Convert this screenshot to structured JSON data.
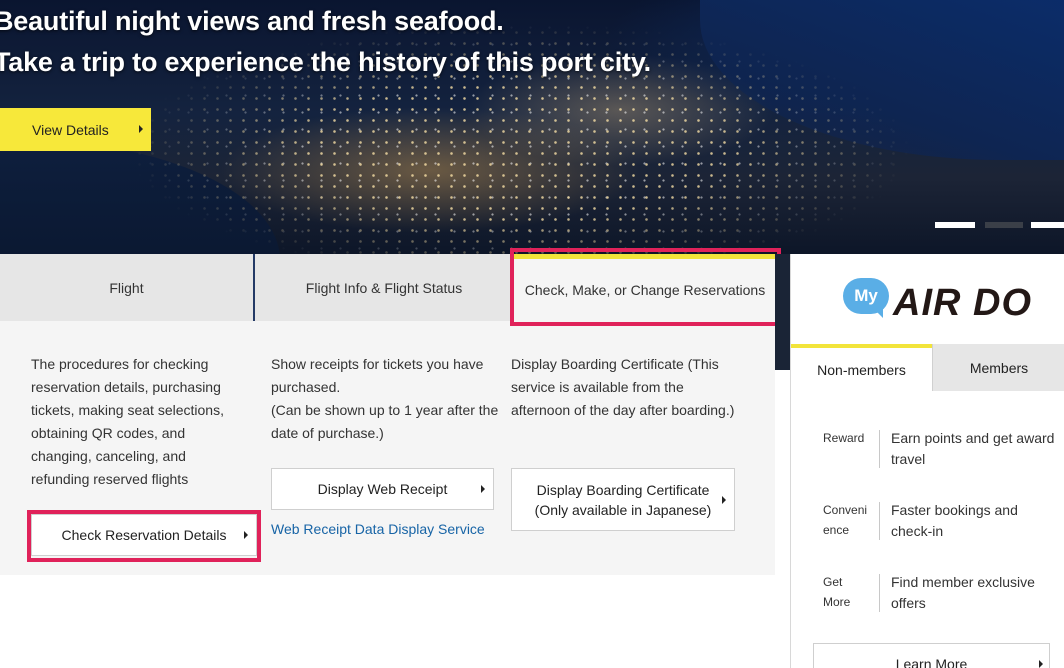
{
  "hero": {
    "line1": "Beautiful night views and fresh seafood.",
    "line2": "Take a trip to experience the history of this port city.",
    "cta_label": "View Details"
  },
  "tabs": [
    {
      "label": "Flight"
    },
    {
      "label": "Flight Info & Flight Status"
    },
    {
      "label": "Check, Make, or Change Reservations"
    }
  ],
  "panel": {
    "col1": {
      "desc": "The procedures for checking reservation details, purchasing tickets, making seat selections, obtaining QR codes, and changing, canceling, and refunding reserved flights",
      "button": "Check Reservation Details"
    },
    "col2": {
      "desc": "Show receipts for tickets you have purchased.",
      "desc_note": "(Can be shown up to 1 year after the date of purchase.)",
      "button": "Display Web Receipt",
      "link": "Web Receipt Data Display Service"
    },
    "col3": {
      "desc": "Display Boarding Certificate (This service is available from the afternoon of the day after boarding.)",
      "button_line1": "Display Boarding Certificate",
      "button_line2": "(Only available in Japanese)"
    }
  },
  "side": {
    "logo_my": "My",
    "logo_text": "AIR DO",
    "tabs": [
      {
        "label": "Non-members"
      },
      {
        "label": "Members"
      }
    ],
    "benefits": [
      {
        "label_line1": "Reward",
        "label_line2": "",
        "text": "Earn points and get award travel"
      },
      {
        "label_line1": "Conveni",
        "label_line2": "ence",
        "text": "Faster bookings and check-in"
      },
      {
        "label_line1": "Get",
        "label_line2": "More",
        "text": "Find member exclusive offers"
      }
    ],
    "learn_more": "Learn More"
  },
  "colors": {
    "accent_yellow": "#f7e83a",
    "highlight": "#e0225a",
    "link_blue": "#1764a6",
    "logo_blue": "#5aaee6"
  }
}
